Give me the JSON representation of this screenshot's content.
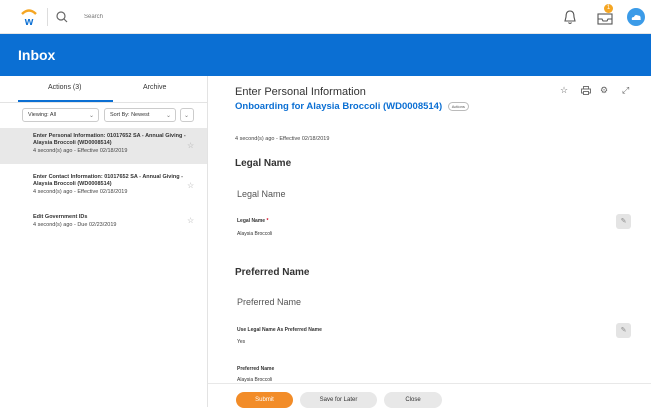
{
  "topbar": {
    "search_placeholder": "Search",
    "notification_count": "1"
  },
  "header": {
    "title": "Inbox"
  },
  "left": {
    "tabs": [
      {
        "label": "Actions (3)"
      },
      {
        "label": "Archive"
      }
    ],
    "filters": {
      "viewing": "Viewing: All",
      "sort": "Sort By: Newest"
    },
    "items": [
      {
        "title": "Enter Personal Information: 01017652 SA - Annual Giving - Alaysia Broccoli (WD0008514)",
        "meta": "4 second(s) ago - Effective 02/18/2019"
      },
      {
        "title": "Enter Contact Information: 01017652 SA - Annual Giving - Alaysia Broccoli (WD0008514)",
        "meta": "4 second(s) ago - Effective 02/18/2019"
      },
      {
        "title": "Edit Government IDs",
        "meta": "4 second(s) ago - Due 02/23/2019"
      }
    ]
  },
  "main": {
    "title": "Enter Personal Information",
    "subtitle": "Onboarding for Alaysia Broccoli (WD0008514)",
    "actions_label": "Actions",
    "meta": "4 second(s) ago - Effective 02/18/2019",
    "legal_section": "Legal Name",
    "legal_sub": "Legal Name",
    "legal_label": "Legal Name",
    "legal_required": "*",
    "legal_value": "Alaysia Broccoli",
    "preferred_section": "Preferred Name",
    "preferred_sub": "Preferred Name",
    "use_legal_label": "Use Legal Name As Preferred Name",
    "use_legal_value": "Yes",
    "preferred_label": "Preferred Name",
    "preferred_value": "Alaysia Broccoli"
  },
  "footer": {
    "submit": "Submit",
    "save_later": "Save for Later",
    "close": "Close"
  },
  "colors": {
    "brand_blue": "#0b6fd3",
    "submit_orange": "#f28c28",
    "badge_orange": "#f5a623"
  },
  "icons": [
    "workday-logo-icon",
    "search-icon",
    "bell-icon",
    "inbox-icon",
    "avatar",
    "chevron-down-icon",
    "star-icon",
    "print-icon",
    "gear-icon",
    "expand-icon",
    "pencil-icon"
  ]
}
